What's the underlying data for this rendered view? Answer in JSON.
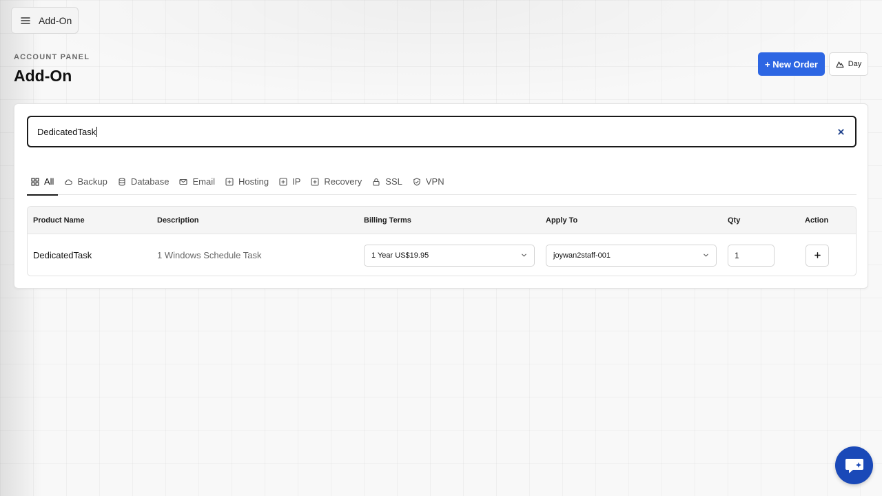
{
  "header": {
    "menu_icon": "hamburger-icon",
    "menu_label": "Add-On",
    "eyebrow": "ACCOUNT PANEL",
    "title": "Add-On"
  },
  "actions": {
    "new_order_label": "+ New Order",
    "day_label": "Day",
    "day_icon": "mountain-icon",
    "accent_color": "#2d66e3"
  },
  "search": {
    "value": "DedicatedTask",
    "clear_icon": "close-icon"
  },
  "tabs": [
    {
      "label": "All",
      "icon": "grid-icon",
      "active": true
    },
    {
      "label": "Backup",
      "icon": "cloud-icon",
      "active": false
    },
    {
      "label": "Database",
      "icon": "database-icon",
      "active": false
    },
    {
      "label": "Email",
      "icon": "mail-icon",
      "active": false
    },
    {
      "label": "Hosting",
      "icon": "plus-square-icon",
      "active": false
    },
    {
      "label": "IP",
      "icon": "plus-square-icon",
      "active": false
    },
    {
      "label": "Recovery",
      "icon": "plus-square-icon",
      "active": false
    },
    {
      "label": "SSL",
      "icon": "lock-icon",
      "active": false
    },
    {
      "label": "VPN",
      "icon": "shield-icon",
      "active": false
    }
  ],
  "table": {
    "columns": [
      "Product Name",
      "Description",
      "Billing Terms",
      "Apply To",
      "Qty",
      "Action"
    ],
    "rows": [
      {
        "product_name": "DedicatedTask",
        "description": "1 Windows Schedule Task",
        "billing_term": "1 Year US$19.95",
        "apply_to": "joywan2staff-001",
        "qty": "1",
        "action_icon": "plus-icon"
      }
    ]
  },
  "chat": {
    "icon": "chat-sparkle-icon",
    "color": "#1a49b8"
  }
}
